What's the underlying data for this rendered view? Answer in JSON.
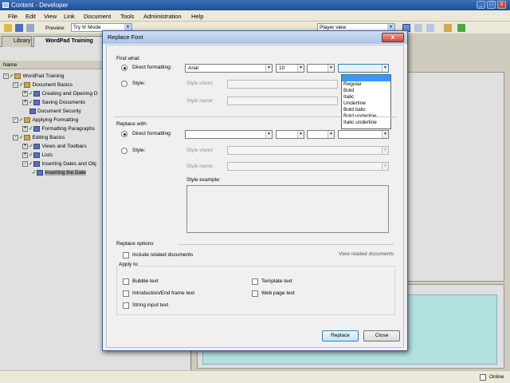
{
  "window": {
    "title": "Content - Developer"
  },
  "menu": [
    "File",
    "Edit",
    "View",
    "Link",
    "Document",
    "Tools",
    "Administration",
    "Help"
  ],
  "toolbar": {
    "preview_label": "Preview:",
    "preview_mode": "Try It! Mode",
    "player_view": "Player view"
  },
  "left_tabs": {
    "library": "Library",
    "document": "WordPad Training"
  },
  "tree": {
    "column": "Name",
    "nodes": [
      {
        "label": "WordPad Training"
      },
      {
        "label": "Document Basics"
      },
      {
        "label": "Creating and Opening D"
      },
      {
        "label": "Saving Documents"
      },
      {
        "label": "Document Security"
      },
      {
        "label": "Applying Formatting"
      },
      {
        "label": "Formatting Paragraphs"
      },
      {
        "label": "Editing Basics"
      },
      {
        "label": "Views and Toolbars"
      },
      {
        "label": "Lists"
      },
      {
        "label": "Inserting Dates and Obj"
      },
      {
        "label": "Inserting the Date"
      }
    ]
  },
  "dialog": {
    "title": "Replace Font",
    "find_what": {
      "section": "Find what:",
      "direct_label": "Direct formatting:",
      "font": "Arial",
      "size": "10",
      "style_label": "Style:",
      "style_sheet_label": "Style sheet:",
      "style_name_label": "Style name:"
    },
    "style_options": [
      "Regular",
      "Bold",
      "Italic",
      "Underline",
      "Bold italic",
      "Bold underline",
      "Italic underline"
    ],
    "replace_with": {
      "section": "Replace with:",
      "direct_label": "Direct formatting:",
      "style_label": "Style:",
      "style_sheet_label": "Style sheet:",
      "style_name_label": "Style name:",
      "style_example_label": "Style example:"
    },
    "options": {
      "section": "Replace options",
      "include_related": "Include related documents",
      "view_related": "View related documents",
      "apply_to": "Apply to:",
      "targets": [
        "Bubble text",
        "Template text",
        "Introduction/End frame text",
        "Web page text",
        "String input text"
      ]
    },
    "buttons": {
      "replace": "Replace",
      "close": "Close"
    }
  },
  "status": {
    "online": "Online"
  }
}
